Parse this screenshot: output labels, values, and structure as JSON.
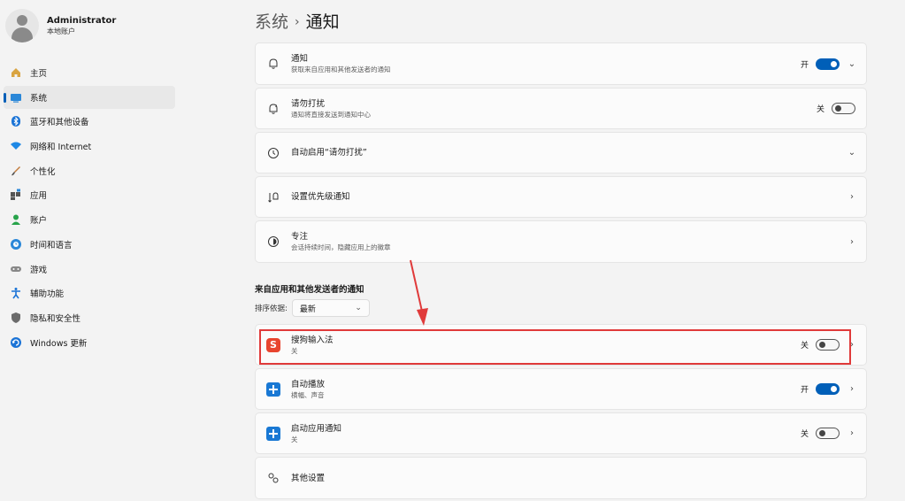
{
  "profile": {
    "name": "Administrator",
    "sub": "本地账户"
  },
  "nav": {
    "items": [
      {
        "label": "主页",
        "icon": "home-icon"
      },
      {
        "label": "系统",
        "icon": "system-icon",
        "active": true
      },
      {
        "label": "蓝牙和其他设备",
        "icon": "bluetooth-icon"
      },
      {
        "label": "网络和 Internet",
        "icon": "wifi-icon"
      },
      {
        "label": "个性化",
        "icon": "brush-icon"
      },
      {
        "label": "应用",
        "icon": "apps-icon"
      },
      {
        "label": "账户",
        "icon": "account-icon"
      },
      {
        "label": "时间和语言",
        "icon": "globe-clock-icon"
      },
      {
        "label": "游戏",
        "icon": "gamepad-icon"
      },
      {
        "label": "辅助功能",
        "icon": "accessibility-icon"
      },
      {
        "label": "隐私和安全性",
        "icon": "shield-icon"
      },
      {
        "label": "Windows 更新",
        "icon": "update-icon"
      }
    ]
  },
  "header": {
    "crumb1": "系统",
    "separator": "›",
    "crumb2": "通知"
  },
  "cards": {
    "notifications": {
      "title": "通知",
      "sub": "获取来自应用和其他发送者的通知",
      "state": "开",
      "icon": "bell-icon"
    },
    "dnd": {
      "title": "请勿打扰",
      "sub": "通知将直接发送到通知中心",
      "state": "关",
      "icon": "bell-snooze-icon"
    },
    "auto_dnd": {
      "title": "自动启用“请勿打扰”",
      "icon": "clock-icon"
    },
    "priority": {
      "title": "设置优先级通知",
      "icon": "priority-icon"
    },
    "focus": {
      "title": "专注",
      "sub": "会话持续时间，隐藏应用上的徽章",
      "icon": "focus-icon"
    }
  },
  "section": {
    "label": "来自应用和其他发送者的通知"
  },
  "sort": {
    "label": "排序依据:",
    "value": "最新"
  },
  "apps": {
    "sogou": {
      "title": "搜狗输入法",
      "sub": "关",
      "state": "关",
      "icon": "sogou-app-icon"
    },
    "autoplay": {
      "title": "自动播放",
      "sub": "横幅、声音",
      "state": "开",
      "icon": "autoplay-app-icon"
    },
    "startup": {
      "title": "启动应用通知",
      "sub": "关",
      "state": "关",
      "icon": "startup-app-icon"
    },
    "other": {
      "title": "其他设置",
      "icon": "gears-icon"
    }
  },
  "colors": {
    "accent": "#005fb8",
    "highlight": "#e03a3a"
  }
}
